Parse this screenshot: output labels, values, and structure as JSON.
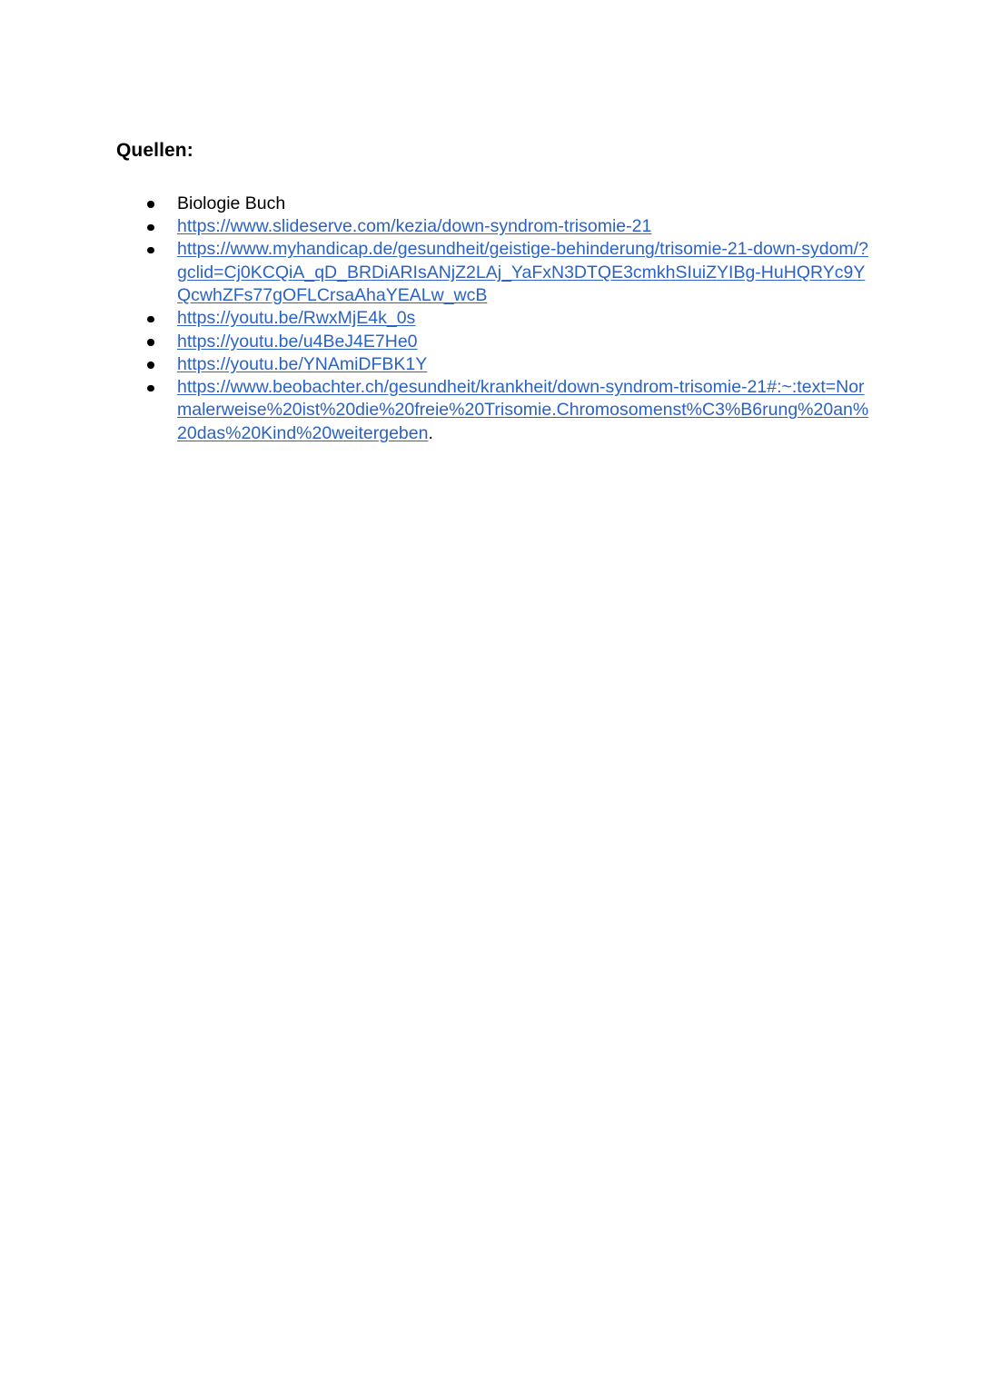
{
  "document": {
    "heading": "Quellen:",
    "link_color": "#2b62c6",
    "text_color": "#000000",
    "background_color": "#ffffff",
    "bullet_glyph": "●",
    "sources": [
      {
        "type": "text",
        "label": "Biologie Buch"
      },
      {
        "type": "link",
        "label": "https://www.slideserve.com/kezia/down-syndrom-trisomie-21"
      },
      {
        "type": "link",
        "label": "https://www.myhandicap.de/gesundheit/geistige-behinderung/trisomie-21-down-sydom/?gclid=Cj0KCQiA_qD_BRDiARIsANjZ2LAj_YaFxN3DTQE3cmkhSIuiZYIBg-HuHQRYc9YQcwhZFs77gOFLCrsaAhaYEALw_wcB"
      },
      {
        "type": "link",
        "label": "https://youtu.be/RwxMjE4k_0s"
      },
      {
        "type": "link",
        "label": "https://youtu.be/u4BeJ4E7He0"
      },
      {
        "type": "link",
        "label": "https://youtu.be/YNAmiDFBK1Y"
      },
      {
        "type": "link",
        "label": "https://www.beobachter.ch/gesundheit/krankheit/down-syndrom-trisomie-21#:~:text=Normalerweise%20ist%20die%20freie%20Trisomie.Chromosomenst%C3%B6rung%20an%20das%20Kind%20weitergeben",
        "suffix": "."
      }
    ]
  }
}
